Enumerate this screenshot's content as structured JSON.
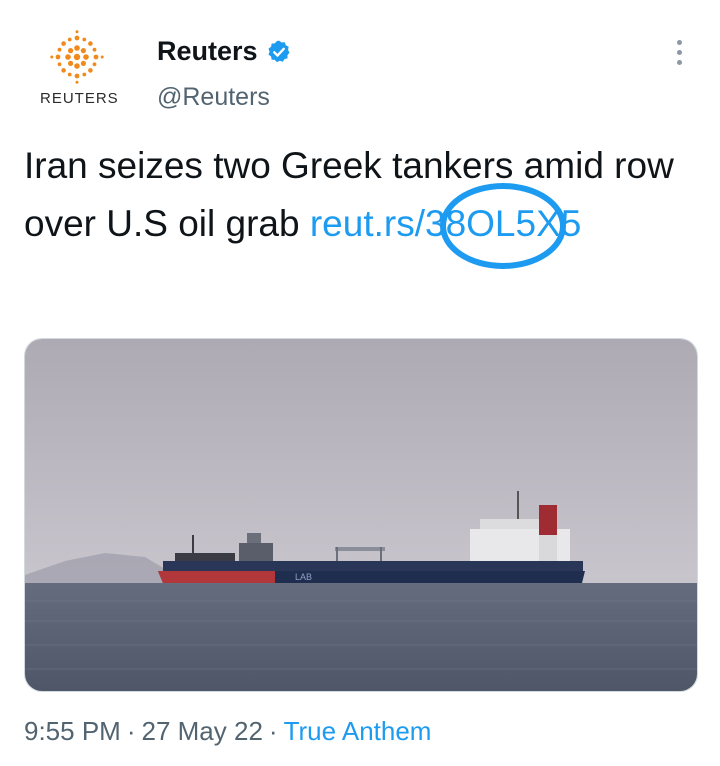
{
  "author": {
    "avatar_logo": "reuters-dot-logo",
    "avatar_wordmark": "REUTERS",
    "name": "Reuters",
    "verified": true,
    "handle": "@Reuters"
  },
  "tweet": {
    "text_part1": "Iran seizes two Greek tankers amid row over U.S oil ",
    "text_part2": "grab",
    "text_space": " ",
    "link": "reut.rs/38OL5X5",
    "annotation": "blue-hand-drawn-circle",
    "media": {
      "description": "oil-tanker-at-sea",
      "hull_marking": "LAB"
    }
  },
  "meta": {
    "time": "9:55 PM",
    "separator": "·",
    "date": "27 May 22",
    "source": "True Anthem"
  },
  "colors": {
    "accent": "#1d9bf0",
    "text": "#0f1419",
    "secondary": "#536471",
    "brand_orange": "#f08a1c"
  }
}
